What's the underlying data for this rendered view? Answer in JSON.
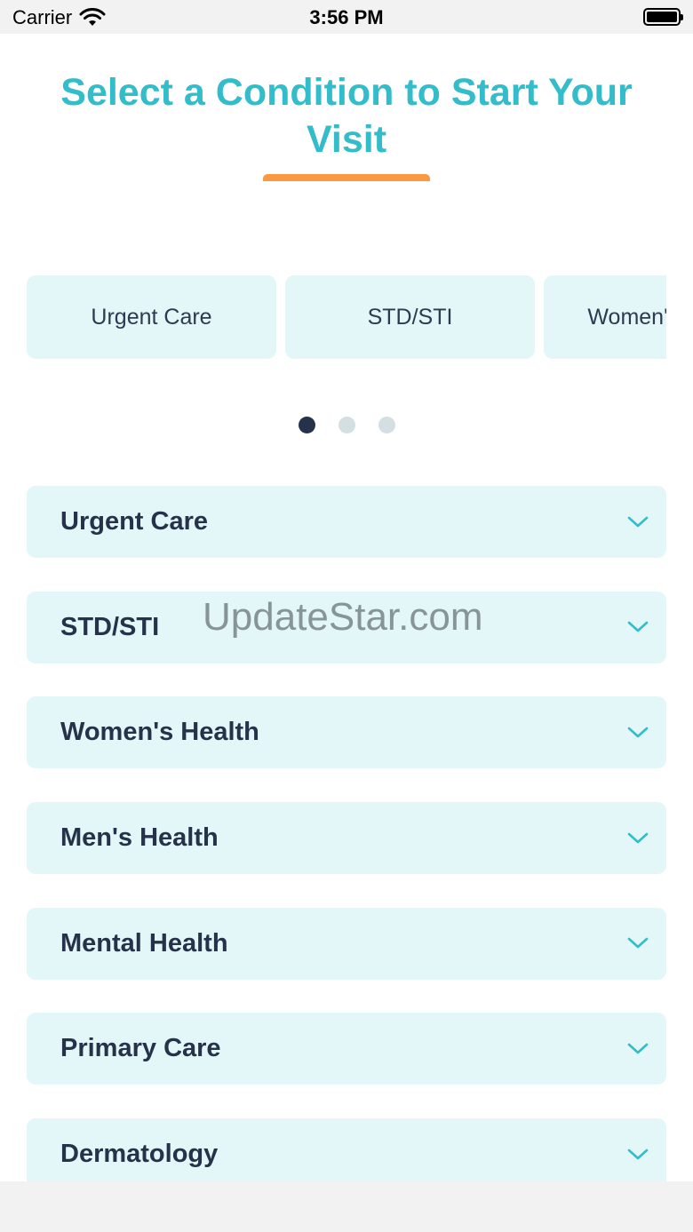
{
  "status_bar": {
    "carrier": "Carrier",
    "time": "3:56 PM",
    "wifi_icon": "wifi-icon",
    "battery_icon": "battery-full-icon"
  },
  "header": {
    "title": "Select a Condition to Start Your Visit"
  },
  "carousel": {
    "cards": [
      "Urgent Care",
      "STD/STI",
      "Women's Health"
    ],
    "page_count": 3,
    "active_page": 1
  },
  "conditions": {
    "items": [
      {
        "label": "Urgent Care"
      },
      {
        "label": "STD/STI"
      },
      {
        "label": "Women's Health"
      },
      {
        "label": "Men's Health"
      },
      {
        "label": "Mental Health"
      },
      {
        "label": "Primary Care"
      },
      {
        "label": "Dermatology"
      }
    ],
    "expand_icon": "chevron-down-icon"
  },
  "watermark": "UpdateStar.com",
  "colors": {
    "accent_teal": "#33bcc9",
    "underline_orange": "#f99a43",
    "card_background": "#e3f6f8",
    "text_dark": "#25324a",
    "dot_active": "#25324a",
    "dot_inactive": "#d3dfe2"
  }
}
